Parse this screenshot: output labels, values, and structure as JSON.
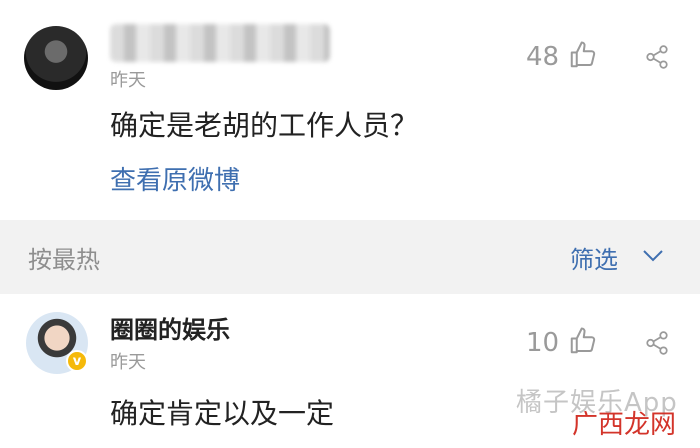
{
  "comment_top": {
    "time": "昨天",
    "like_count": "48",
    "text": "确定是老胡的工作人员？",
    "view_original_link": "查看原微博",
    "icons": {
      "like": "thumbs-up-icon",
      "share": "share-icon",
      "avatar": "avatar-icon"
    }
  },
  "sort_bar": {
    "sort_label": "按最热",
    "filter_label": "筛选",
    "chevron_icon": "chevron-down-icon",
    "accent_color": "#3f6fb0"
  },
  "comment_second": {
    "username": "圈圈的娱乐",
    "time": "昨天",
    "like_count": "10",
    "text": "确定肯定以及一定",
    "verified_badge_text": "v",
    "icons": {
      "like": "thumbs-up-icon",
      "share": "share-icon",
      "avatar": "avatar-icon",
      "badge": "verified-badge-icon"
    }
  },
  "watermark": {
    "line1": "橘子娱乐App",
    "line2": "广西龙网"
  }
}
